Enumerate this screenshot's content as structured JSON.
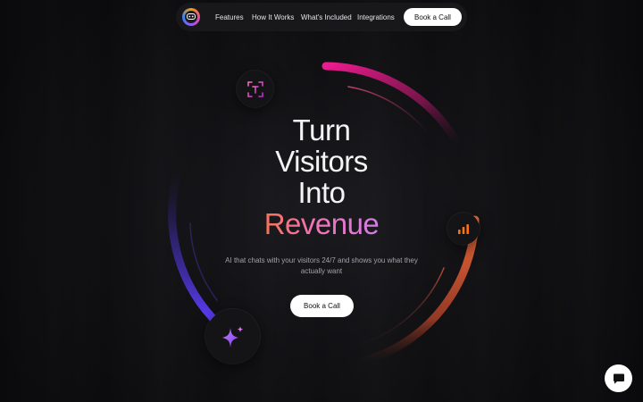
{
  "nav": {
    "links": [
      "Features",
      "How It Works",
      "What's Included",
      "Integrations"
    ],
    "cta_label": "Book a Call"
  },
  "hero": {
    "headline_lines": [
      "Turn",
      "Visitors",
      "Into"
    ],
    "headline_accent": "Revenue",
    "subtitle": "AI that chats with your visitors 24/7 and shows you what they actually want",
    "cta_label": "Book a Call"
  },
  "icons": {
    "logo": "chat-logo-icon",
    "top_left": "text-frame-icon",
    "right": "bar-chart-icon",
    "bottom_left": "sparkle-icon",
    "chat": "chat-bubble-icon"
  },
  "colors": {
    "background": "#0b0b0d",
    "accent_pink": "#e11d8a",
    "accent_orange": "#f97316",
    "accent_purple": "#6d28d9",
    "cta_bg": "#ffffff"
  }
}
